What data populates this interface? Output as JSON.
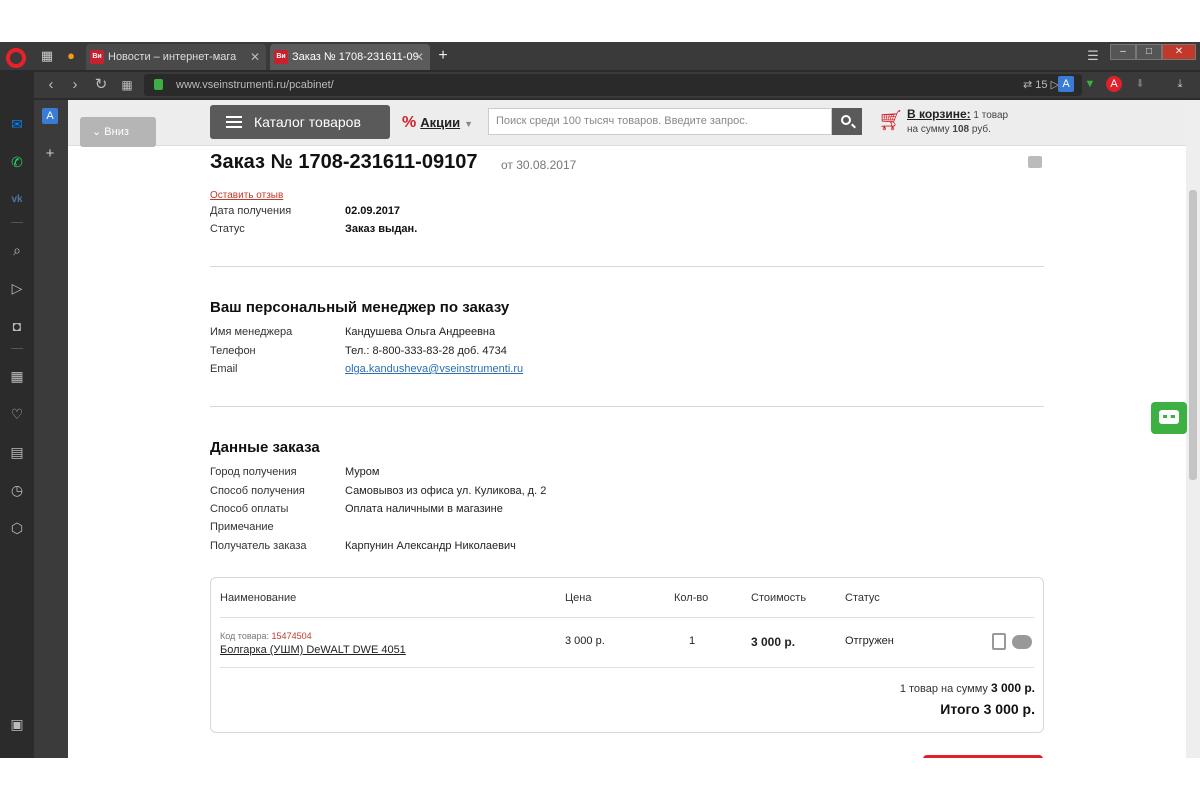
{
  "browser": {
    "tabs": [
      {
        "label": "Новости – интернет-мага",
        "favicon": "Ви"
      },
      {
        "label": "Заказ № 1708-231611-09",
        "favicon": "Ви"
      }
    ],
    "url": "www.vseinstrumenti.ru/pcabinet/",
    "ext_badge_count": "15",
    "new_tab_symbol": "+"
  },
  "site_header": {
    "down_button": "Вниз",
    "catalog_button": "Каталог товаров",
    "promo_label": "Акции",
    "search_placeholder": "Поиск среди 100 тысяч товаров. Введите запрос.",
    "cart_title": "В корзине:",
    "cart_count_text": "1 товар",
    "cart_sum_prefix": "на сумму",
    "cart_sum_value": "108",
    "cart_sum_suffix": "руб."
  },
  "order": {
    "title": "Заказ № 1708-231611-09107",
    "date": "от 30.08.2017",
    "feedback_link": "Оставить отзыв",
    "details": [
      {
        "label": "Дата получения",
        "value": "02.09.2017"
      },
      {
        "label": "Статус",
        "value": "Заказ выдан."
      }
    ]
  },
  "manager": {
    "heading": "Ваш персональный менеджер по заказу",
    "rows": [
      {
        "label": "Имя менеджера",
        "value": "Кандушева Ольга Андреевна"
      },
      {
        "label": "Телефон",
        "value": "Тел.: 8-800-333-83-28 доб. 4734"
      },
      {
        "label": "Email",
        "value": "olga.kandusheva@vseinstrumenti.ru"
      }
    ]
  },
  "order_data": {
    "heading": "Данные заказа",
    "rows": [
      {
        "label": "Город получения",
        "value": "Муром"
      },
      {
        "label": "Способ получения",
        "value": "Самовывоз из офиса ул. Куликова, д. 2"
      },
      {
        "label": "Способ оплаты",
        "value": "Оплата наличными в магазине"
      },
      {
        "label": "Примечание",
        "value": ""
      },
      {
        "label": "Получатель заказа",
        "value": "Карпунин Александр Николаевич"
      }
    ]
  },
  "items_table": {
    "headers": [
      "Наименование",
      "Цена",
      "Кол-во",
      "Стоимость",
      "Статус"
    ],
    "rows": [
      {
        "code_label": "Код товара:",
        "code": "15474504",
        "name": "Болгарка (УШМ) DeWALT DWE 4051",
        "price": "3 000 р.",
        "qty": "1",
        "cost": "3 000 р.",
        "status": "Отгружен"
      }
    ],
    "summary_prefix": "1 товар на сумму",
    "summary_value": "3 000 р.",
    "total": "Итого 3 000 р."
  },
  "colors": {
    "accent_red": "#d0202a",
    "link_blue": "#2a6db5",
    "chat_green": "#3cb043"
  }
}
